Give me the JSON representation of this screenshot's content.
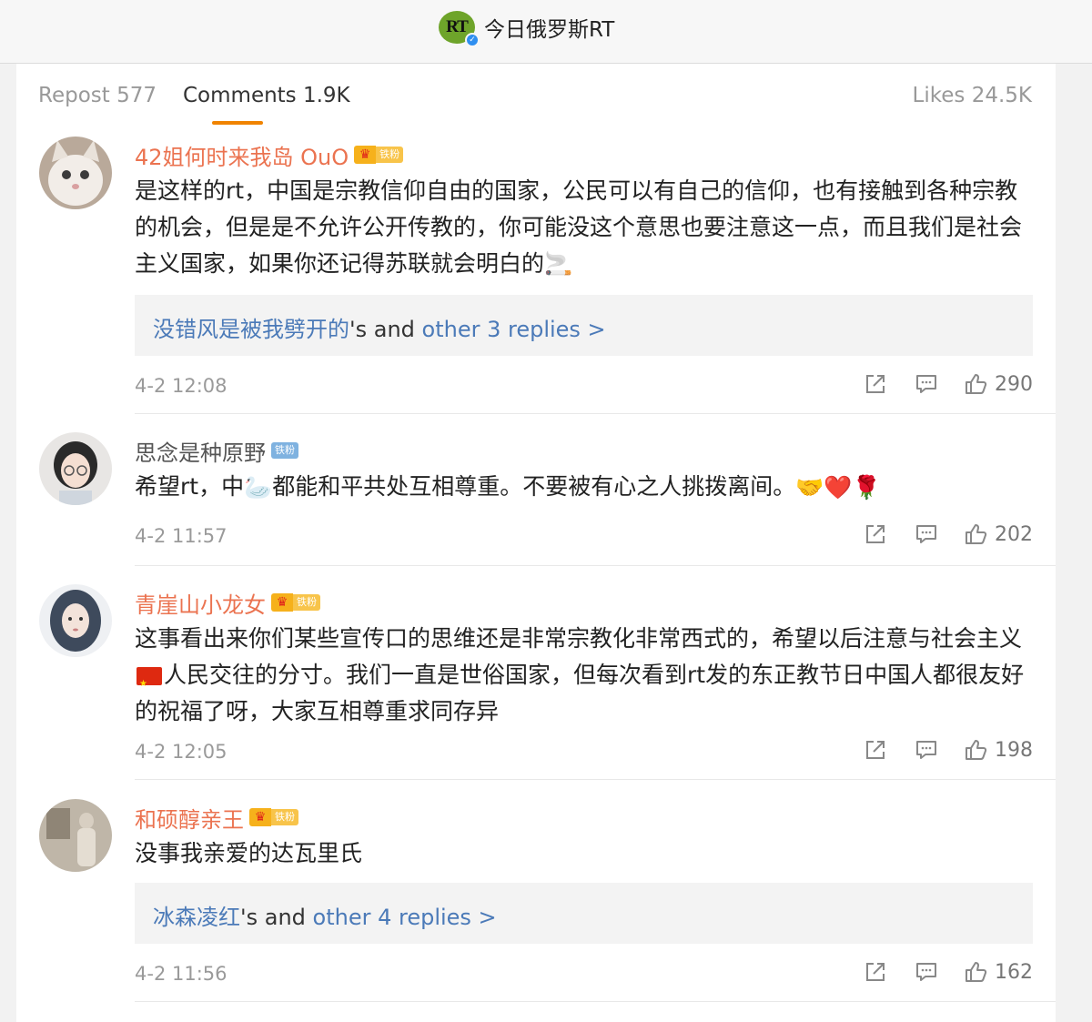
{
  "header": {
    "account": "今日俄罗斯RT",
    "logo_text": "RT"
  },
  "tabs": {
    "repost": "Repost 577",
    "comments": "Comments 1.9K",
    "likes": "Likes 24.5K"
  },
  "comments": [
    {
      "user": "42姐何时来我岛 OuO",
      "badge": "铁粉",
      "text": "是这样的rt，中国是宗教信仰自由的国家，公民可以有自己的信仰，也有接触到各种宗教的机会，但是是不允许公开传教的，你可能没这个意思也要注意这一点，而且我们是社会主义国家，如果你还记得苏联就会明白的🚬",
      "reply_user": "没错风是被我劈开的",
      "reply_mid": "'s and ",
      "reply_link": "other 3 replies >",
      "time": "4-2 12:08",
      "likes": "290"
    },
    {
      "user": "思念是种原野",
      "badge": "铁粉",
      "text_a": "希望rt，中",
      "text_b": "都能和平共处互相尊重。不要被有心之人挑拨离间。",
      "emoji_swan": "🦢",
      "emoji_end": "🤝❤️🌹",
      "time": "4-2 11:57",
      "likes": "202"
    },
    {
      "user": "青崖山小龙女",
      "badge": "铁粉",
      "text_a": "这事看出来你们某些宣传口的思维还是非常宗教化非常西式的，希望以后注意与社会主义",
      "text_b": "人民交往的分寸。我们一直是世俗国家，但每次看到rt发的东正教节日中国人都很友好的祝福了呀，大家互相尊重求同存异",
      "time": "4-2 12:05",
      "likes": "198"
    },
    {
      "user": "和硕醇亲王",
      "badge": "铁粉",
      "text": "没事我亲爱的达瓦里氏",
      "reply_user": "冰森凌红",
      "reply_mid": "'s and ",
      "reply_link": "other 4 replies >",
      "time": "4-2 11:56",
      "likes": "162"
    }
  ],
  "colors": {
    "accent": "#f08300",
    "username": "#eb7350",
    "link": "#4b7ab8"
  }
}
